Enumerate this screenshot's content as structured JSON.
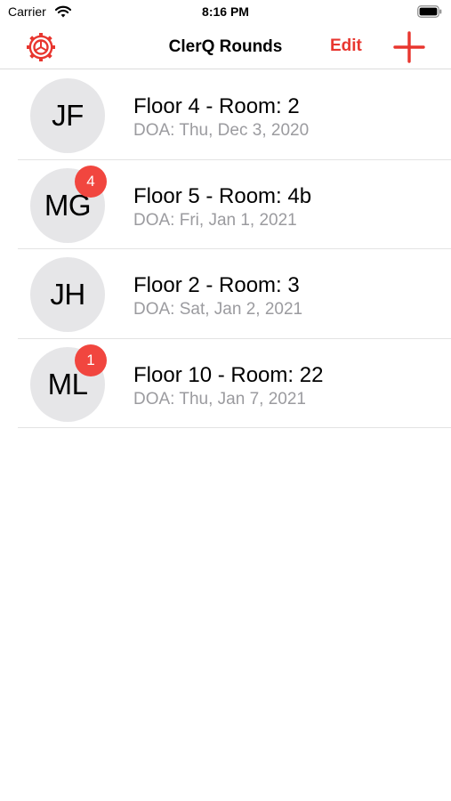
{
  "status_bar": {
    "carrier": "Carrier",
    "time": "8:16 PM"
  },
  "nav": {
    "title": "ClerQ Rounds",
    "edit_label": "Edit",
    "accent_color": "#e8362f"
  },
  "patients": [
    {
      "initials": "JF",
      "badge": "",
      "title": "Floor 4 - Room: 2",
      "subtitle": "DOA: Thu, Dec 3, 2020"
    },
    {
      "initials": "MG",
      "badge": "4",
      "title": "Floor 5 - Room: 4b",
      "subtitle": "DOA: Fri, Jan 1, 2021"
    },
    {
      "initials": "JH",
      "badge": "",
      "title": "Floor 2 - Room: 3",
      "subtitle": "DOA: Sat, Jan 2, 2021"
    },
    {
      "initials": "ML",
      "badge": "1",
      "title": "Floor 10 - Room: 22",
      "subtitle": "DOA: Thu, Jan 7, 2021"
    }
  ]
}
